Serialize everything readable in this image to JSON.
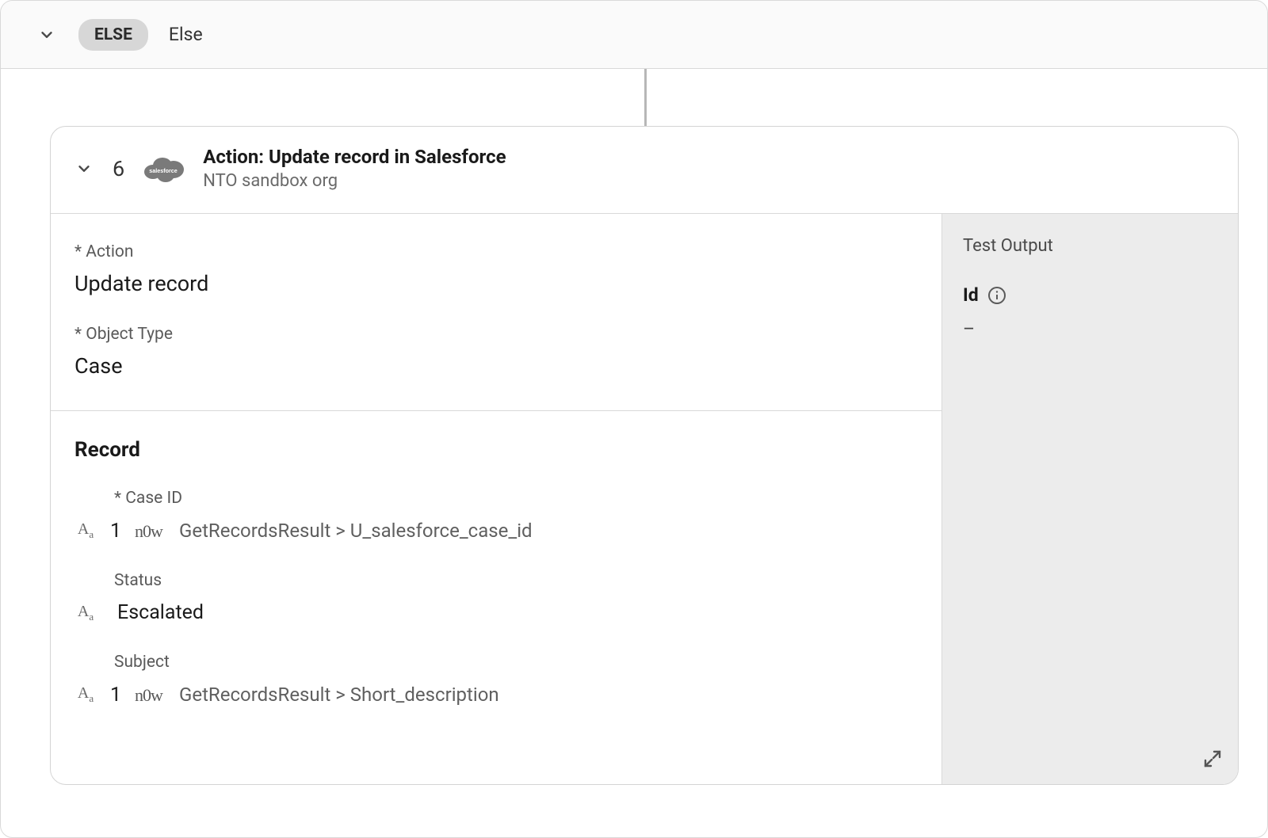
{
  "else_bar": {
    "pill": "ELSE",
    "label": "Else"
  },
  "card": {
    "step_number": "6",
    "title": "Action: Update record in Salesforce",
    "subtitle": "NTO sandbox org"
  },
  "action_section": {
    "action_label": "* Action",
    "action_value": "Update record",
    "object_type_label": "* Object Type",
    "object_type_value": "Case"
  },
  "record_section": {
    "heading": "Record",
    "fields": [
      {
        "label": "* Case ID",
        "has_now_ref": true,
        "ref_index": "1",
        "path": "GetRecordsResult > U_salesforce_case_id",
        "plain_value": null
      },
      {
        "label": "Status",
        "has_now_ref": false,
        "ref_index": null,
        "path": null,
        "plain_value": "Escalated"
      },
      {
        "label": "Subject",
        "has_now_ref": true,
        "ref_index": "1",
        "path": "GetRecordsResult > Short_description",
        "plain_value": null
      }
    ]
  },
  "test_output": {
    "title": "Test Output",
    "rows": [
      {
        "label": "Id",
        "value": "–"
      }
    ]
  },
  "icons": {
    "salesforce": "salesforce-cloud-icon",
    "servicenow": "servicenow-now-icon",
    "text_type": "text-aa-icon",
    "info": "info-icon",
    "chevron_down": "chevron-down-icon",
    "expand": "expand-icon"
  }
}
